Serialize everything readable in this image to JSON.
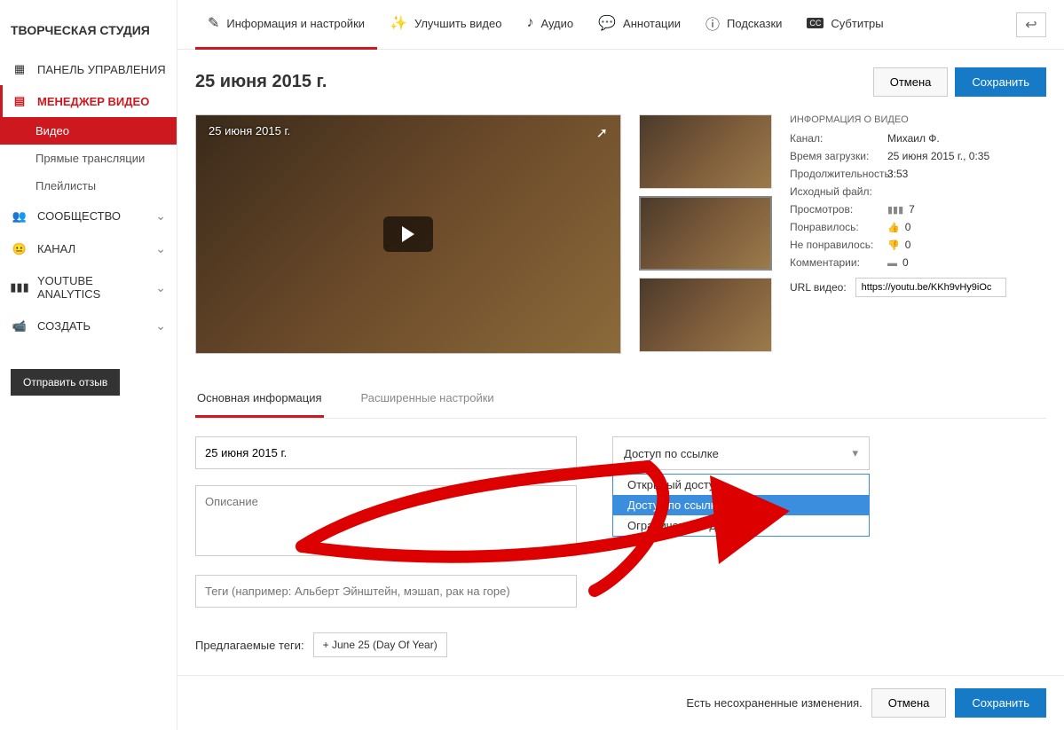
{
  "sidebar": {
    "title": "ТВОРЧЕСКАЯ СТУДИЯ",
    "dashboard": "ПАНЕЛЬ УПРАВЛЕНИЯ",
    "video_manager": "МЕНЕДЖЕР ВИДЕО",
    "sub": {
      "videos": "Видео",
      "live": "Прямые трансляции",
      "playlists": "Плейлисты"
    },
    "community": "СООБЩЕСТВО",
    "channel": "КАНАЛ",
    "analytics": "YOUTUBE ANALYTICS",
    "create": "СОЗДАТЬ",
    "feedback": "Отправить отзыв"
  },
  "tabs": {
    "info": "Информация и настройки",
    "enhance": "Улучшить видео",
    "audio": "Аудио",
    "annotations": "Аннотации",
    "cards": "Подсказки",
    "subtitles": "Субтитры"
  },
  "page": {
    "title": "25 июня 2015 г.",
    "cancel": "Отмена",
    "save": "Сохранить"
  },
  "player": {
    "title": "25 июня 2015 г."
  },
  "info": {
    "header": "ИНФОРМАЦИЯ О ВИДЕО",
    "channel_lbl": "Канал:",
    "channel_val": "Михаил Ф.",
    "uploaded_lbl": "Время загрузки:",
    "uploaded_val": "25 июня 2015 г., 0:35",
    "duration_lbl": "Продолжительность:",
    "duration_val": "3:53",
    "raw_lbl": "Исходный файл:",
    "views_lbl": "Просмотров:",
    "views_val": "7",
    "likes_lbl": "Понравилось:",
    "likes_val": "0",
    "dislikes_lbl": "Не понравилось:",
    "dislikes_val": "0",
    "comments_lbl": "Комментарии:",
    "comments_val": "0",
    "url_lbl": "URL видео:",
    "url_val": "https://youtu.be/KKh9vHy9iOc"
  },
  "subtabs": {
    "basic": "Основная информация",
    "advanced": "Расширенные настройки"
  },
  "form": {
    "title_val": "25 июня 2015 г.",
    "desc_ph": "Описание",
    "tags_ph": "Теги (например: Альберт Эйнштейн, мэшап, рак на горе)",
    "suggested_lbl": "Предлагаемые теги:",
    "tag1": "+ June 25 (Day Of Year)"
  },
  "privacy": {
    "selected": "Доступ по ссылке",
    "opt_public": "Открытый доступ",
    "opt_unlisted": "Доступ по ссылке",
    "opt_private": "Ограниченный доступ"
  },
  "footer": {
    "unsaved": "Есть несохраненные изменения.",
    "cancel": "Отмена",
    "save": "Сохранить"
  }
}
